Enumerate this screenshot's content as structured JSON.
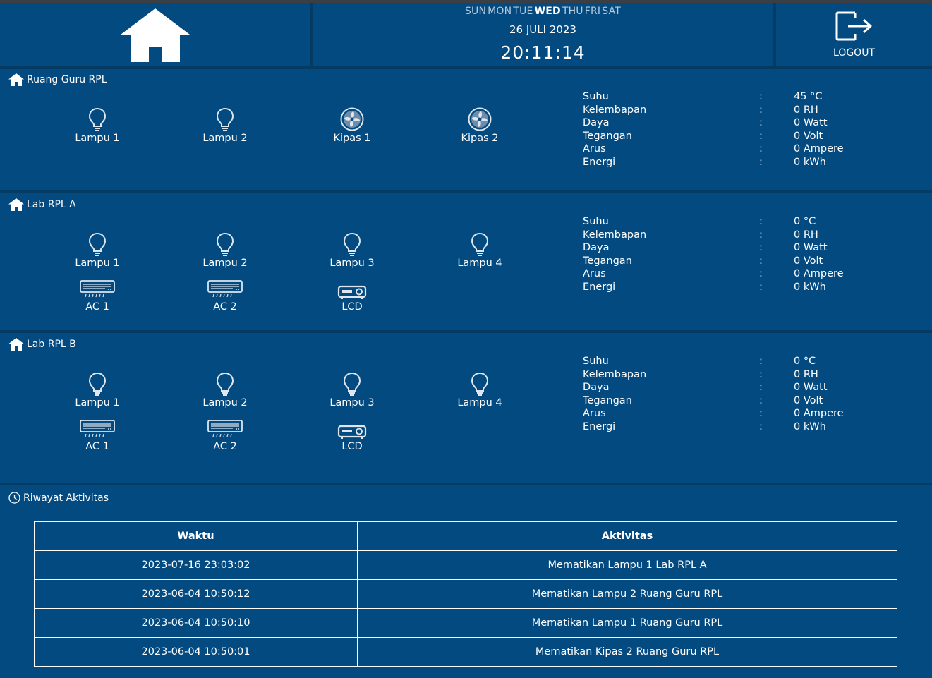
{
  "header": {
    "days": [
      {
        "label": "SUN",
        "active": false
      },
      {
        "label": "MON",
        "active": false
      },
      {
        "label": "TUE",
        "active": false
      },
      {
        "label": "WED",
        "active": true
      },
      {
        "label": "THU",
        "active": false
      },
      {
        "label": "FRI",
        "active": false
      },
      {
        "label": "SAT",
        "active": false
      }
    ],
    "date": "26 JULI 2023",
    "time": "20:11:14",
    "logout_label": "LOGOUT",
    "home_icon": "home-icon",
    "logout_icon": "logout-icon"
  },
  "rooms": [
    {
      "name": "Ruang Guru RPL",
      "devices": [
        {
          "label": "Lampu 1",
          "icon": "bulb-icon"
        },
        {
          "label": "Lampu 2",
          "icon": "bulb-icon"
        },
        {
          "label": "Kipas 1",
          "icon": "fan-icon"
        },
        {
          "label": "Kipas 2",
          "icon": "fan-icon"
        }
      ],
      "stats": [
        {
          "label": "Suhu",
          "value": "45 °C"
        },
        {
          "label": "Kelembapan",
          "value": "0 RH"
        },
        {
          "label": "Daya",
          "value": "0 Watt"
        },
        {
          "label": "Tegangan",
          "value": "0 Volt"
        },
        {
          "label": "Arus",
          "value": "0 Ampere"
        },
        {
          "label": "Energi",
          "value": "0 kWh"
        }
      ]
    },
    {
      "name": "Lab RPL A",
      "devices": [
        {
          "label": "Lampu 1",
          "icon": "bulb-icon"
        },
        {
          "label": "Lampu 2",
          "icon": "bulb-icon"
        },
        {
          "label": "Lampu 3",
          "icon": "bulb-icon"
        },
        {
          "label": "Lampu 4",
          "icon": "bulb-icon"
        },
        {
          "label": "AC 1",
          "icon": "ac-icon"
        },
        {
          "label": "AC 2",
          "icon": "ac-icon"
        },
        {
          "label": "LCD",
          "icon": "projector-icon"
        }
      ],
      "stats": [
        {
          "label": "Suhu",
          "value": "0 °C"
        },
        {
          "label": "Kelembapan",
          "value": "0 RH"
        },
        {
          "label": "Daya",
          "value": "0 Watt"
        },
        {
          "label": "Tegangan",
          "value": "0 Volt"
        },
        {
          "label": "Arus",
          "value": "0 Ampere"
        },
        {
          "label": "Energi",
          "value": "0 kWh"
        }
      ]
    },
    {
      "name": "Lab RPL B",
      "devices": [
        {
          "label": "Lampu 1",
          "icon": "bulb-icon"
        },
        {
          "label": "Lampu 2",
          "icon": "bulb-icon"
        },
        {
          "label": "Lampu 3",
          "icon": "bulb-icon"
        },
        {
          "label": "Lampu 4",
          "icon": "bulb-icon"
        },
        {
          "label": "AC 1",
          "icon": "ac-icon"
        },
        {
          "label": "AC 2",
          "icon": "ac-icon"
        },
        {
          "label": "LCD",
          "icon": "projector-icon"
        }
      ],
      "stats": [
        {
          "label": "Suhu",
          "value": "0 °C"
        },
        {
          "label": "Kelembapan",
          "value": "0 RH"
        },
        {
          "label": "Daya",
          "value": "0 Watt"
        },
        {
          "label": "Tegangan",
          "value": "0 Volt"
        },
        {
          "label": "Arus",
          "value": "0 Ampere"
        },
        {
          "label": "Energi",
          "value": "0 kWh"
        }
      ]
    }
  ],
  "stat_separator": ":",
  "history": {
    "title": "Riwayat Aktivitas",
    "icon": "clock-icon",
    "columns": [
      "Waktu",
      "Aktivitas"
    ],
    "rows": [
      [
        "2023-07-16 23:03:02",
        "Mematikan Lampu 1 Lab RPL A"
      ],
      [
        "2023-06-04 10:50:12",
        "Mematikan Lampu 2 Ruang Guru RPL"
      ],
      [
        "2023-06-04 10:50:10",
        "Mematikan Lampu 1 Ruang Guru RPL"
      ],
      [
        "2023-06-04 10:50:01",
        "Mematikan Kipas 2 Ruang Guru RPL"
      ]
    ]
  },
  "colors": {
    "background": "#034a80",
    "separator": "#053a63",
    "icon": "#dfe6ee",
    "inactive_day": "#b9c9d8"
  }
}
